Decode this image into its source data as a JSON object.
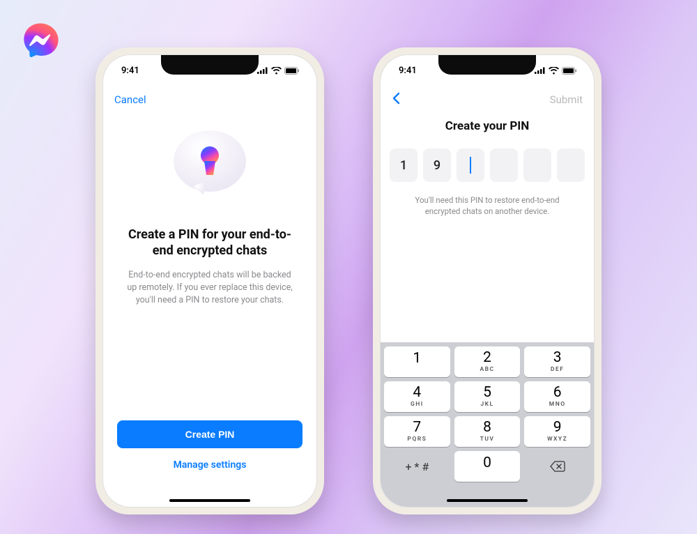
{
  "status": {
    "time": "9:41"
  },
  "screen1": {
    "cancel": "Cancel",
    "title": "Create a PIN for your end-to-end encrypted chats",
    "description": "End-to-end encrypted chats will be backed up remotely. If you ever replace this device, you'll need a PIN to restore your chats.",
    "primary_button": "Create PIN",
    "secondary_link": "Manage settings"
  },
  "screen2": {
    "submit": "Submit",
    "title": "Create your PIN",
    "pin_values": [
      "1",
      "9",
      "",
      "",
      "",
      ""
    ],
    "active_index": 2,
    "description": "You'll need this PIN to restore end-to-end encrypted chats on another device."
  },
  "keypad": {
    "keys": [
      [
        {
          "digit": "1",
          "letters": ""
        },
        {
          "digit": "2",
          "letters": "ABC"
        },
        {
          "digit": "3",
          "letters": "DEF"
        }
      ],
      [
        {
          "digit": "4",
          "letters": "GHI"
        },
        {
          "digit": "5",
          "letters": "JKL"
        },
        {
          "digit": "6",
          "letters": "MNO"
        }
      ],
      [
        {
          "digit": "7",
          "letters": "PQRS"
        },
        {
          "digit": "8",
          "letters": "TUV"
        },
        {
          "digit": "9",
          "letters": "WXYZ"
        }
      ],
      [
        {
          "digit": "+ * #",
          "util": true
        },
        {
          "digit": "0",
          "letters": ""
        },
        {
          "digit": "⌫",
          "util": true
        }
      ]
    ]
  }
}
